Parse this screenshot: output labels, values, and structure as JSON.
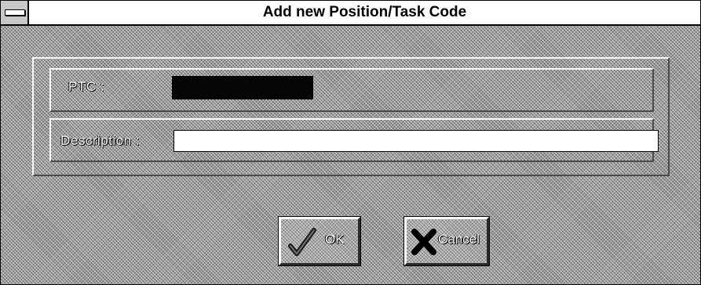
{
  "window": {
    "title": "Add new Position/Task Code"
  },
  "form": {
    "ptc_label": "PTC :",
    "ptc_value": "",
    "description_label": "Description :",
    "description_value": ""
  },
  "buttons": {
    "ok_label": "OK",
    "cancel_label": "Cancel"
  },
  "icons": {
    "system_menu": "system-menu-icon",
    "ok": "checkmark-icon",
    "cancel": "x-icon"
  }
}
